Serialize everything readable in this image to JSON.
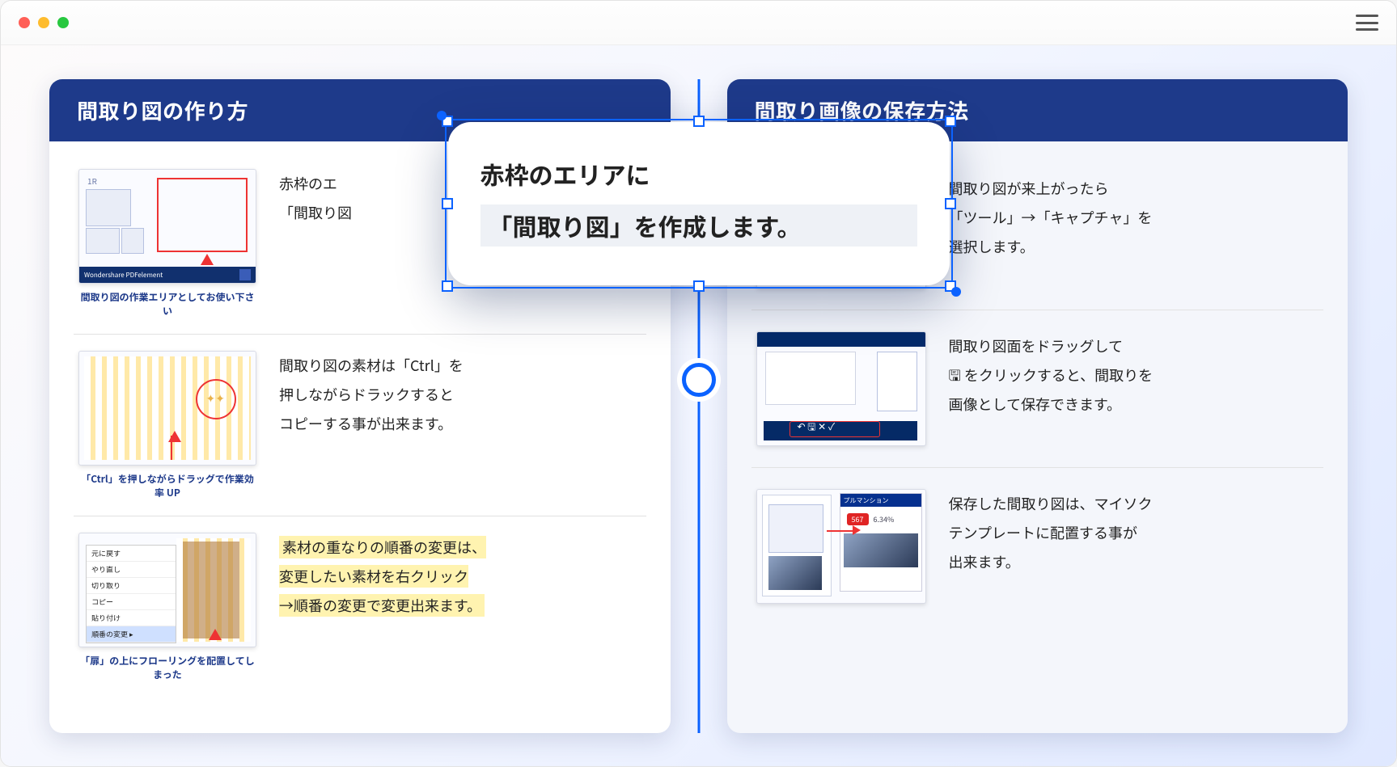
{
  "left": {
    "title": "間取り図の作り方",
    "rows": [
      {
        "desc": "赤枠のエ\n「間取り図",
        "caption": "間取り図の作業エリアとしてお使い下さい"
      },
      {
        "desc": "間取り図の素材は「Ctrl」を\n押しながらドラックすると\nコピーする事が出来ます。",
        "caption": "「Ctrl」を押しながらドラッグで作業効率 UP"
      },
      {
        "desc": "素材の重なりの順番の変更は、\n変更したい素材を右クリック\n→順番の変更で変更出来ます。",
        "caption": "「扉」の上にフローリングを配置してしまった",
        "highlight": true
      }
    ]
  },
  "right": {
    "title": "間取り画像の保存方法",
    "rows": [
      {
        "desc": "間取り図が来上がったら\n「ツール」→「キャプチャ」を\n選択します。",
        "capturelabel": "キャプチャ"
      },
      {
        "desc": "間取り図面をドラッグして\n🖫 をクリックすると、間取りを\n画像として保存できます。"
      },
      {
        "desc": "保存した間取り図は、マイソク\nテンプレートに配置する事が\n出来ます。",
        "prop_title": "プルマンション",
        "prop_num": "567",
        "prop_pct": "6.34%"
      }
    ]
  },
  "callout": {
    "line1": "赤枠のエリアに",
    "line2": "「間取り図」を作成します。"
  },
  "thumb_misc": {
    "product": "Wondershare PDFelement",
    "label_1r": "1R"
  }
}
